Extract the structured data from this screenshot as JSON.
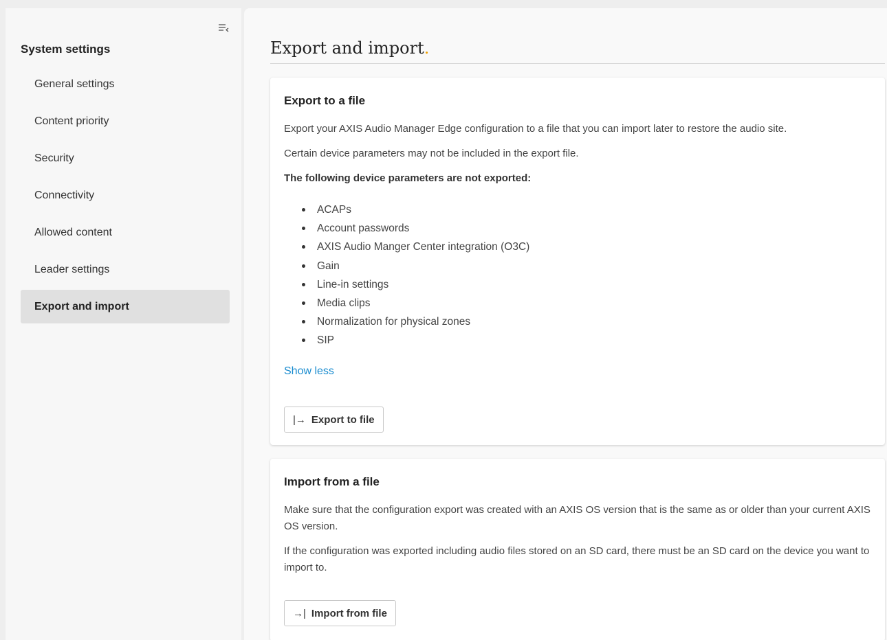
{
  "sidebar": {
    "collapse_icon": "collapse-sidebar-icon",
    "title": "System settings",
    "items": [
      {
        "label": "General settings",
        "active": false
      },
      {
        "label": "Content priority",
        "active": false
      },
      {
        "label": "Security",
        "active": false
      },
      {
        "label": "Connectivity",
        "active": false
      },
      {
        "label": "Allowed content",
        "active": false
      },
      {
        "label": "Leader settings",
        "active": false
      },
      {
        "label": "Export and import",
        "active": true
      }
    ]
  },
  "main": {
    "title": "Export and import",
    "title_dot": ".",
    "accent_color": "#f0a000",
    "link_color": "#1a8ccf"
  },
  "export_card": {
    "heading": "Export to a file",
    "para1": "Export your AXIS Audio Manager Edge configuration to a file that you can import later to restore the audio site.",
    "para2": "Certain device parameters may not be included in the export file.",
    "para3": "The following device parameters are not exported:",
    "params": [
      "ACAPs",
      "Account passwords",
      "AXIS Audio Manger Center integration (O3C)",
      "Gain",
      "Line-in settings",
      "Media clips",
      "Normalization for physical zones",
      "SIP"
    ],
    "show_less": "Show less",
    "button_label": "Export to file",
    "button_glyph": "|→",
    "button_icon": "export-icon"
  },
  "import_card": {
    "heading": "Import from a file",
    "para1": "Make sure that the configuration export was created with an AXIS OS version that is the same as or older than your current AXIS OS version.",
    "para2": "If the configuration was exported including audio files stored on an SD card, there must be an SD card on the device you want to import to.",
    "button_label": "Import from file",
    "button_glyph": "→|",
    "button_icon": "import-icon"
  }
}
